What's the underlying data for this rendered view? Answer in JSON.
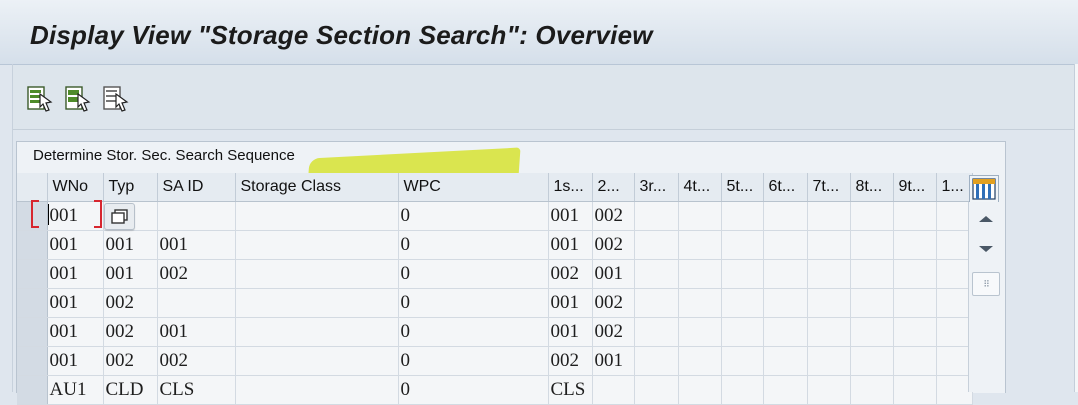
{
  "header": {
    "title": "Display View \"Storage Section Search\": Overview"
  },
  "toolbar": {
    "buttons": [
      {
        "icon": "details-icon"
      },
      {
        "icon": "select-all-icon"
      },
      {
        "icon": "deselect-all-icon"
      }
    ]
  },
  "panel": {
    "title": "Determine Stor. Sec. Search Sequence"
  },
  "table": {
    "columns": [
      "WNo",
      "Typ",
      "SA ID",
      "Storage Class",
      "WPC",
      "1s...",
      "2...",
      "3r...",
      "4t...",
      "5t...",
      "6t...",
      "7t...",
      "8t...",
      "9t...",
      "1..."
    ],
    "rows": [
      [
        "001",
        "",
        "",
        "",
        "0",
        "001",
        "002",
        "",
        "",
        "",
        "",
        "",
        "",
        "",
        ""
      ],
      [
        "001",
        "001",
        "001",
        "",
        "0",
        "001",
        "002",
        "",
        "",
        "",
        "",
        "",
        "",
        "",
        ""
      ],
      [
        "001",
        "001",
        "002",
        "",
        "0",
        "002",
        "001",
        "",
        "",
        "",
        "",
        "",
        "",
        "",
        ""
      ],
      [
        "001",
        "002",
        "",
        "",
        "0",
        "001",
        "002",
        "",
        "",
        "",
        "",
        "",
        "",
        "",
        ""
      ],
      [
        "001",
        "002",
        "001",
        "",
        "0",
        "001",
        "002",
        "",
        "",
        "",
        "",
        "",
        "",
        "",
        ""
      ],
      [
        "001",
        "002",
        "002",
        "",
        "0",
        "002",
        "001",
        "",
        "",
        "",
        "",
        "",
        "",
        "",
        ""
      ],
      [
        "AU1",
        "CLD",
        "CLS",
        "",
        "0",
        "CLS",
        "",
        "",
        "",
        "",
        "",
        "",
        "",
        "",
        ""
      ]
    ]
  },
  "colors": {
    "highlight": "#d5e22a",
    "focus": "#d7262f",
    "title_bar": "#dfe6ee"
  }
}
